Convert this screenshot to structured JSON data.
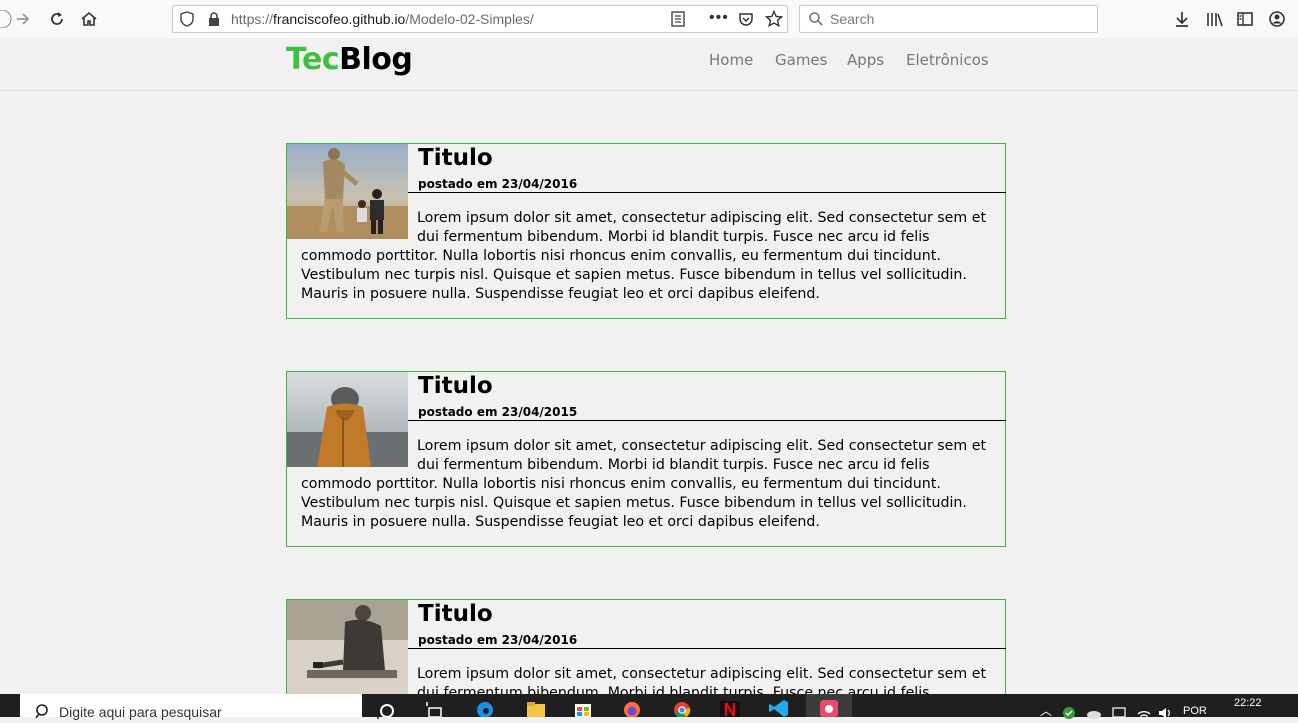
{
  "browser": {
    "url_prefix": "https://",
    "url_host": "franciscofeo.github.io",
    "url_path": "/Modelo-02-Simples/",
    "search_placeholder": "Search"
  },
  "site": {
    "logo_part1": "Tec",
    "logo_part2": "Blog",
    "nav": [
      "Home",
      "Games",
      "Apps",
      "Eletrônicos"
    ]
  },
  "posts": [
    {
      "title": "Titulo",
      "date": "postado em 23/04/2016",
      "body": "Lorem ipsum dolor sit amet, consectetur adipiscing elit. Sed consectetur sem et dui fermentum bibendum. Morbi id blandit turpis. Fusce nec arcu id felis commodo porttitor. Nulla lobortis nisi rhoncus enim convallis, eu fermentum dui tincidunt. Vestibulum nec turpis nisl. Quisque et sapien metus. Fusce bibendum in tellus vel sollicitudin. Mauris in posuere nulla. Suspendisse feugiat leo et orci dapibus eleifend."
    },
    {
      "title": "Titulo",
      "date": "postado em 23/04/2015",
      "body": "Lorem ipsum dolor sit amet, consectetur adipiscing elit. Sed consectetur sem et dui fermentum bibendum. Morbi id blandit turpis. Fusce nec arcu id felis commodo porttitor. Nulla lobortis nisi rhoncus enim convallis, eu fermentum dui tincidunt. Vestibulum nec turpis nisl. Quisque et sapien metus. Fusce bibendum in tellus vel sollicitudin. Mauris in posuere nulla. Suspendisse feugiat leo et orci dapibus eleifend."
    },
    {
      "title": "Titulo",
      "date": "postado em 23/04/2016",
      "body": "Lorem ipsum dolor sit amet, consectetur adipiscing elit. Sed consectetur sem et dui fermentum bibendum. Morbi id blandit turpis. Fusce nec arcu id felis commodo porttitor."
    }
  ],
  "taskbar": {
    "search_placeholder": "Digite aqui para pesquisar",
    "language": "POR",
    "time": "22:22"
  },
  "colors": {
    "accent_green": "#3ec03e",
    "post_border": "#43b443",
    "page_bg": "#f1f1f1"
  }
}
